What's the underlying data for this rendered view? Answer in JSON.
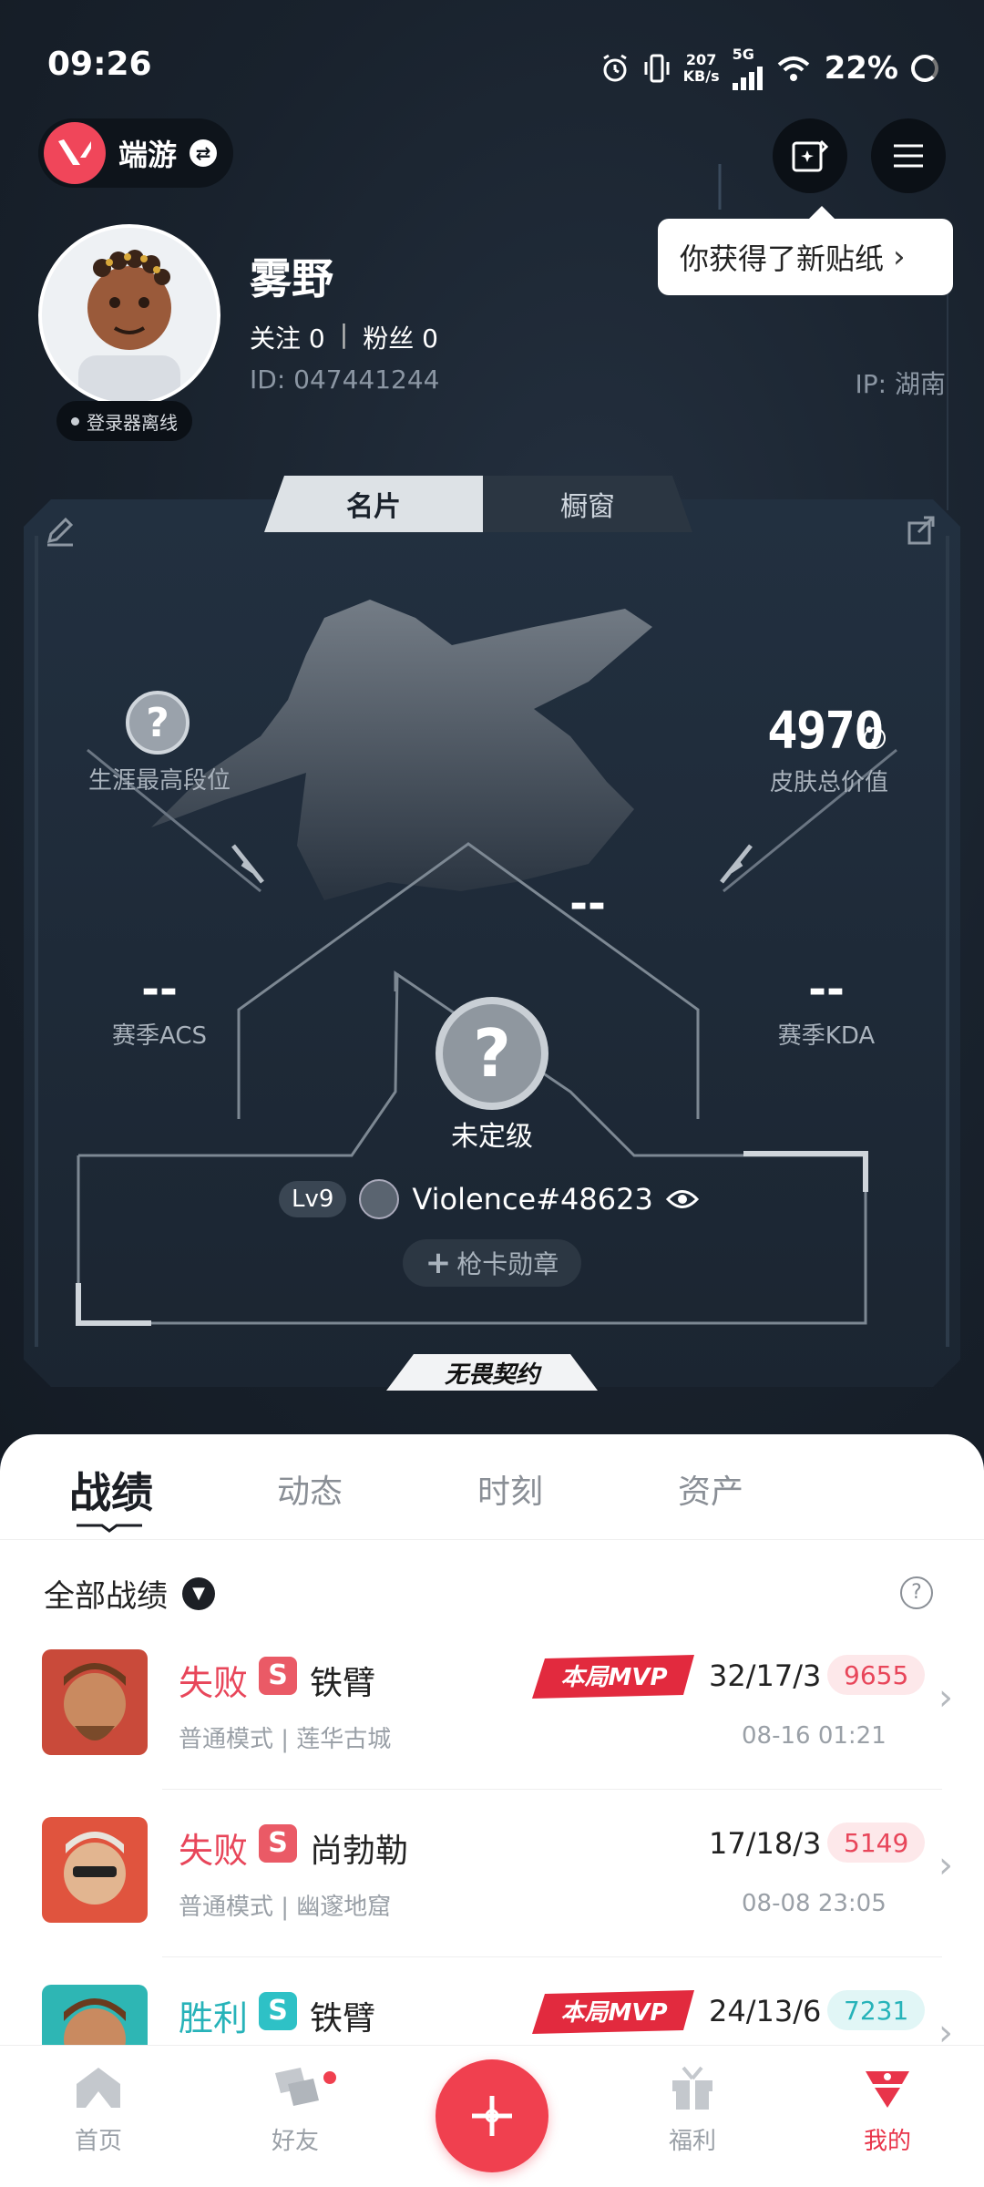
{
  "status_bar": {
    "time": "09:26",
    "speed_value": "207",
    "speed_unit": "KB/s",
    "network": "5G",
    "battery": "22%"
  },
  "header": {
    "brand_name": "端游",
    "tooltip": "你获得了新贴纸"
  },
  "profile": {
    "username": "雾野",
    "following_label": "关注",
    "following_count": "0",
    "fans_label": "粉丝",
    "fans_count": "0",
    "id_text": "ID:  047441244",
    "ip_text": "IP:  湖南",
    "online_status": "登录器离线"
  },
  "card": {
    "tabs": [
      "名片",
      "橱窗"
    ],
    "career_rank_label": "生涯最高段位",
    "skin_value": "4970",
    "skin_value_label": "皮肤总价值",
    "center_value": "--",
    "acs_value": "--",
    "acs_label": "赛季ACS",
    "kda_value": "--",
    "kda_label": "赛季KDA",
    "rank_label": "未定级",
    "level": "Lv9",
    "gamer_tag": "Violence#48623",
    "medal_button": "枪卡勋章",
    "footer_logo": "无畏契约"
  },
  "sheet": {
    "tabs": [
      "战绩",
      "动态",
      "时刻",
      "资产"
    ],
    "filter_label": "全部战绩"
  },
  "matches": [
    {
      "result": "失败",
      "result_color": "#e8465a",
      "badge": "S",
      "badge_color": "#ea5a66",
      "agent": "铁臂",
      "mode": "普通模式 | 莲华古城",
      "mvp": true,
      "mvp_text": "本局MVP",
      "kda": "32/17/3",
      "score": "9655",
      "score_bg": "#fde8ea",
      "score_color": "#e8465a",
      "date": "08-16 01:21"
    },
    {
      "result": "失败",
      "result_color": "#e8465a",
      "badge": "S",
      "badge_color": "#ea5a66",
      "agent": "尚勃勒",
      "mode": "普通模式 | 幽邃地窟",
      "mvp": false,
      "mvp_text": "",
      "kda": "17/18/3",
      "score": "5149",
      "score_bg": "#fde8ea",
      "score_color": "#e8465a",
      "date": "08-08 23:05"
    },
    {
      "result": "胜利",
      "result_color": "#27b3b9",
      "badge": "S",
      "badge_color": "#2ec1c6",
      "agent": "铁臂",
      "mode": "",
      "mvp": true,
      "mvp_text": "本局MVP",
      "kda": "24/13/6",
      "score": "7231",
      "score_bg": "#e1f6f6",
      "score_color": "#27b3b9",
      "date": ""
    }
  ],
  "bottom_nav": {
    "items": [
      "首页",
      "好友",
      "",
      "福利",
      "我的"
    ]
  }
}
